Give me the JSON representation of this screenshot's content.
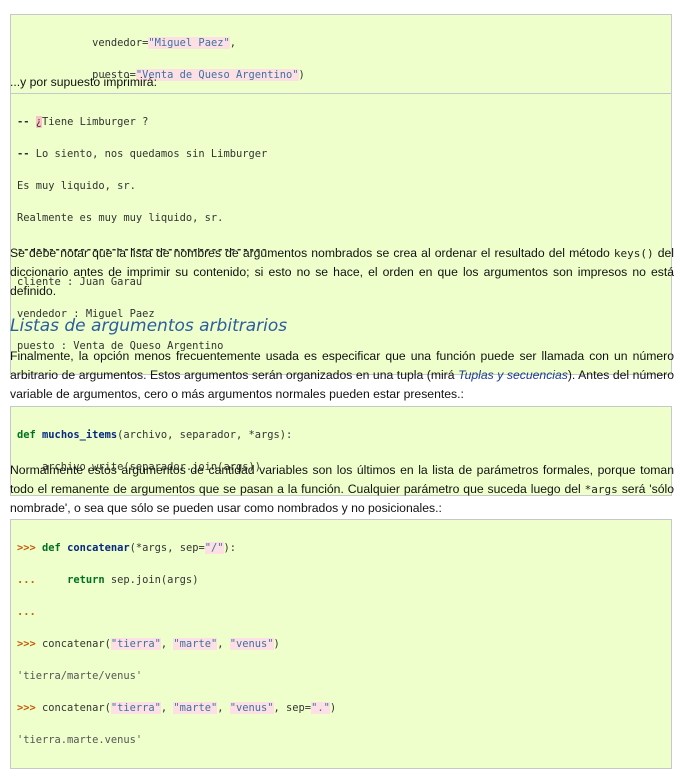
{
  "block1": {
    "l1_indent": "            ",
    "l1_key": "vendedor=",
    "l1_val": "\"Miguel Paez\"",
    "l1_end": ",",
    "l2_indent": "            ",
    "l2_key": "puesto=",
    "l2_val": "\"Venta de Queso Argentino\"",
    "l2_end": ")"
  },
  "intro1": "...y por supuesto imprimirá:",
  "output": {
    "l1_dash": "-- ",
    "l1_mark": "¿",
    "l1_text": "Tiene Limburger ?",
    "l2_dash": "--",
    "l2_text": " Lo siento, nos quedamos sin Limburger",
    "l3": "Es muy liquido, sr.",
    "l4": "Realmente es muy muy liquido, sr.",
    "l5": "----------------------------------------",
    "l6": "cliente : Juan Garau",
    "l7": "vendedor : Miguel Paez",
    "l8": "puesto : Venta de Queso Argentino"
  },
  "para1": {
    "before": "Se debe notar que la lista de nombres de argumentos nombrados se crea al ordenar el resultado del método ",
    "code": "keys()",
    "after": " del diccionario antes de imprimir su contenido; si esto no se hace, el orden en que los argumentos son impresos no está definido."
  },
  "heading": "Listas de argumentos arbitrarios",
  "para2": {
    "before": "Finalmente, la opción menos frecuentemente usada es especificar que una función puede ser llamada con un número arbitrario de argumentos. Estos argumentos serán organizados en una tupla (mirá ",
    "link": "Tuplas y secuencias",
    "after": "). Antes del número variable de argumentos, cero o más argumentos normales pueden estar presentes.:"
  },
  "block2": {
    "kw": "def",
    "fn": "muchos_items",
    "sig": "(archivo, separador, *args):",
    "l2": "    archivo.write(separador.join(args))"
  },
  "para3": {
    "before": "Normalmente estos argumentos de cantidad variables son los últimos en la lista de parámetros formales, porque toman todo el remanente de argumentos que se pasan a la función. Cualquier parámetro que suceda luego del ",
    "code": "*args",
    "after": " será 'sólo nombrade', o sea que sólo se pueden usar como nombrados y no posicionales.:"
  },
  "block3": {
    "p1": ">>>",
    "def": "def",
    "fn": "concatenar",
    "sig1": "(*args, sep=",
    "sep1": "\"/\"",
    "sig2": "):",
    "p2": "...",
    "ret": "return",
    "retrest": " sep.join(args)",
    "p3": "...",
    "call": " concatenar(",
    "a1": "\"tierra\"",
    "comma": ", ",
    "a2": "\"marte\"",
    "a3": "\"venus\"",
    "close": ")",
    "out1": "'tierra/marte/venus'",
    "sepkw": ", sep=",
    "sep2": "\".\"",
    "out2": "'tierra.marte.venus'"
  }
}
